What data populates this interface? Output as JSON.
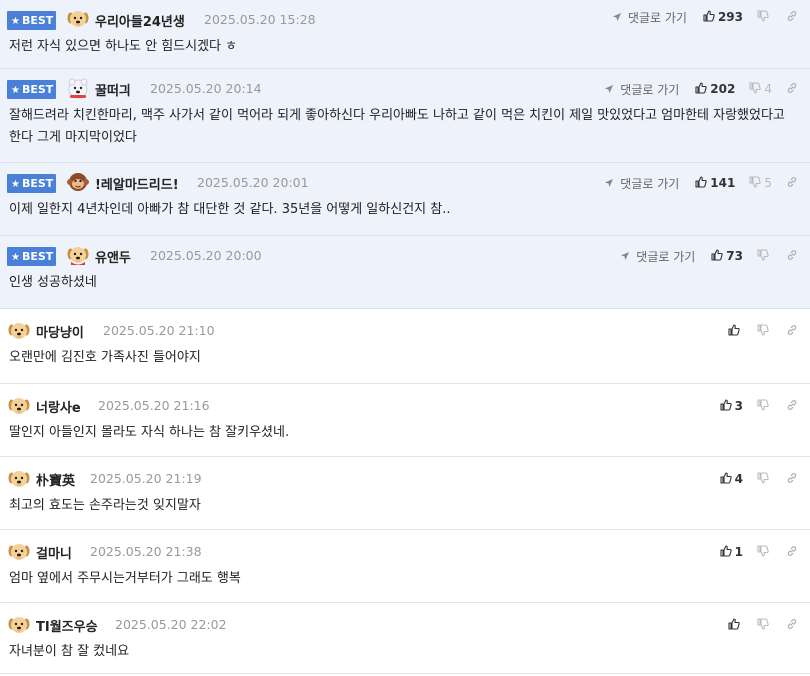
{
  "labels": {
    "best": "BEST",
    "goto_reply": "댓글로 가기"
  },
  "colors": {
    "best_bg": "#eef2fa",
    "best_badge": "#4a80d8",
    "date": "#999999"
  },
  "comments": [
    {
      "best": true,
      "nick": "우리아들24년생",
      "date": "2025.05.20 15:28",
      "up": "293",
      "down": "",
      "text": "저런 자식 있으면 하나도 안 힘드시겠다 ㅎ",
      "avatar": "dog-avatar"
    },
    {
      "best": true,
      "nick": "꿀떠긔",
      "date": "2025.05.20 20:14",
      "up": "202",
      "down": "4",
      "text": "잘해드려라 치킨한마리, 맥주 사가서 같이 먹어라 되게 좋아하신다 우리아빠도 나하고 같이 먹은 치킨이 제일 맛있었다고 엄마한테 자랑했었다고 한다 그게 마지막이었다",
      "avatar": "polar-bear-avatar"
    },
    {
      "best": true,
      "nick": "!레알마드리드!",
      "date": "2025.05.20 20:01",
      "up": "141",
      "down": "5",
      "text": "이제 일한지 4년차인데 아빠가 참 대단한 것 같다. 35년을 어떻게 일하신건지 참..",
      "avatar": "monkey-avatar"
    },
    {
      "best": true,
      "nick": "유앤두",
      "date": "2025.05.20 20:00",
      "up": "73",
      "down": "",
      "text": "인생 성공하셨네",
      "avatar": "dog-red-avatar"
    },
    {
      "best": false,
      "nick": "마당냥이",
      "date": "2025.05.20 21:10",
      "up": "",
      "down": "",
      "text": "오랜만에 김진호 가족사진 들어야지",
      "avatar": "dog-avatar"
    },
    {
      "best": false,
      "nick": "너랑사e",
      "date": "2025.05.20 21:16",
      "up": "3",
      "down": "",
      "text": "딸인지 아들인지 몰라도 자식 하나는 참 잘키우셨네.",
      "avatar": "dog-avatar"
    },
    {
      "best": false,
      "nick": "朴寶英",
      "date": "2025.05.20 21:19",
      "up": "4",
      "down": "",
      "text": "최고의 효도는 손주라는것 잊지말자",
      "avatar": "dog-avatar"
    },
    {
      "best": false,
      "nick": "걸마니",
      "date": "2025.05.20 21:38",
      "up": "1",
      "down": "",
      "text": "엄마 옆에서 주무시는거부터가 그래도 행복",
      "avatar": "dog-avatar"
    },
    {
      "best": false,
      "nick": "TI월즈우승",
      "date": "2025.05.20 22:02",
      "up": "",
      "down": "",
      "text": "자녀분이 참 잘 컸네요",
      "avatar": "dog-avatar"
    }
  ]
}
